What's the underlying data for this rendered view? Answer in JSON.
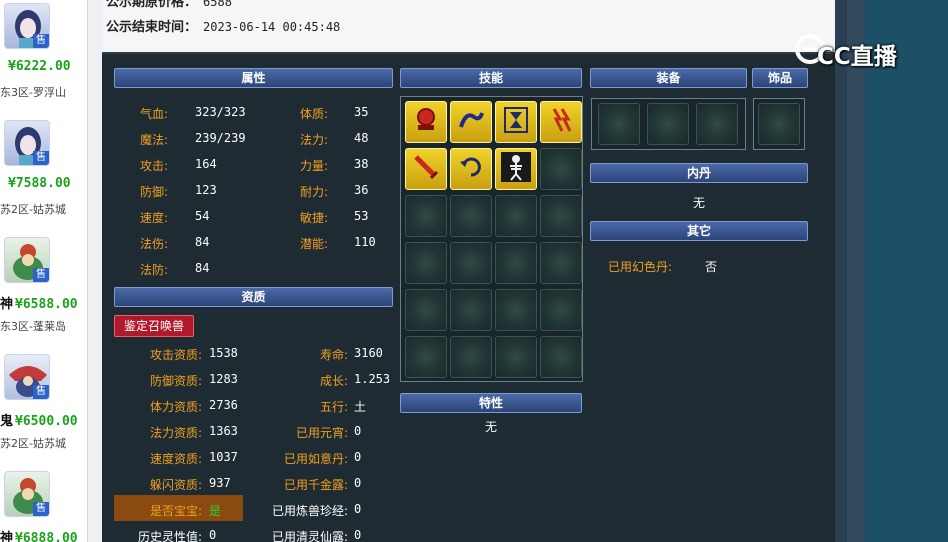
{
  "listing": [
    {
      "price": "¥6222.00",
      "server": "东3区-罗浮山",
      "sale": "售"
    },
    {
      "price": "¥7588.00",
      "server": "苏2区-姑苏城",
      "sale": "售"
    },
    {
      "price": "¥6588.00",
      "server": "东3区-蓬莱岛",
      "sale": "售"
    },
    {
      "price": "¥6500.00",
      "server": "苏2区-姑苏城",
      "sale": "售"
    },
    {
      "price": "¥6888.00",
      "server": "",
      "sale": "售"
    }
  ],
  "listing_prefix": [
    "",
    "",
    "神",
    "鬼",
    "神"
  ],
  "public": {
    "row1_label": "公示期原价格：",
    "row1_value": "6588",
    "end_label": "公示结束时间：",
    "end_value": "2023-06-14 00:45:48"
  },
  "sections": {
    "attr": "属性",
    "skills": "技能",
    "equip": "装备",
    "accessory": "饰品",
    "neidan": "内丹",
    "other": "其它",
    "aptitude": "资质",
    "trait": "特性"
  },
  "attributes": [
    {
      "label": "气血:",
      "value": "323/323"
    },
    {
      "label": "体质:",
      "value": "35"
    },
    {
      "label": "魔法:",
      "value": "239/239"
    },
    {
      "label": "法力:",
      "value": "48"
    },
    {
      "label": "攻击:",
      "value": "164"
    },
    {
      "label": "力量:",
      "value": "38"
    },
    {
      "label": "防御:",
      "value": "123"
    },
    {
      "label": "耐力:",
      "value": "36"
    },
    {
      "label": "速度:",
      "value": "54"
    },
    {
      "label": "敏捷:",
      "value": "53"
    },
    {
      "label": "法伤:",
      "value": "84"
    },
    {
      "label": "潜能:",
      "value": "110"
    },
    {
      "label": "法防:",
      "value": "84"
    }
  ],
  "identify_button": "鉴定召唤兽",
  "aptitude_left": [
    {
      "label": "攻击资质:",
      "value": "1538"
    },
    {
      "label": "防御资质:",
      "value": "1283"
    },
    {
      "label": "体力资质:",
      "value": "2736"
    },
    {
      "label": "法力资质:",
      "value": "1363"
    },
    {
      "label": "速度资质:",
      "value": "1037"
    },
    {
      "label": "躲闪资质:",
      "value": "937"
    },
    {
      "label": "是否宝宝:",
      "value": "是"
    },
    {
      "label": "历史灵性值:",
      "value": "0"
    }
  ],
  "aptitude_right": [
    {
      "label": "寿命:",
      "value": "3160"
    },
    {
      "label": "成长:",
      "value": "1.253"
    },
    {
      "label": "五行:",
      "value": "土"
    },
    {
      "label": "已用元宵:",
      "value": "0"
    },
    {
      "label": "已用如意丹:",
      "value": "0"
    },
    {
      "label": "已用千金露:",
      "value": "0"
    },
    {
      "label": "已用炼兽珍经:",
      "value": "0"
    },
    {
      "label": "已用清灵仙露:",
      "value": "0"
    }
  ],
  "neidan_value": "无",
  "other": {
    "label": "已用幻色丹:",
    "value": "否"
  },
  "trait_value": "无",
  "skills": [
    "tent-icon",
    "dragon-icon",
    "hourglass-icon",
    "lightning-icon",
    "sword-icon",
    "reverse-arrow-icon",
    "skeleton-icon"
  ],
  "logo": "CC直播"
}
